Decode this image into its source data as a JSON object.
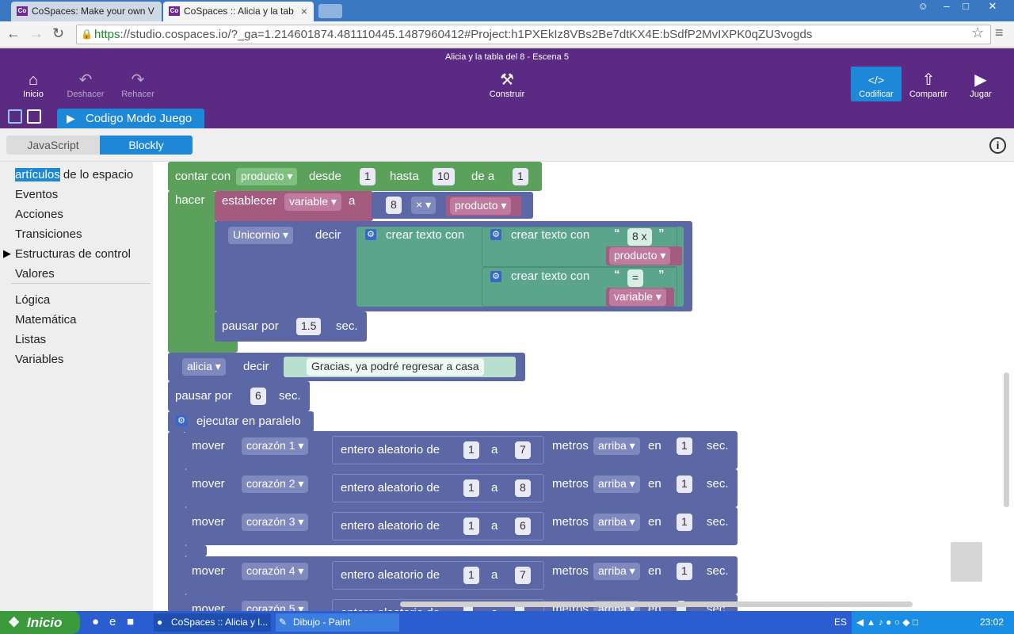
{
  "browser": {
    "tabs": [
      {
        "title": "CoSpaces: Make your own V"
      },
      {
        "title": "CoSpaces :: Alicia y la tab"
      }
    ],
    "url_scheme": "https",
    "url_rest": "://studio.cospaces.io/?_ga=1.214601874.481110445.1487960412#Project:h1PXEkIz8VBs2Be7dtKX4E:bSdfP2MvIXPK0qZU3vogds"
  },
  "app": {
    "title": "Alicia y la tabla del 8 - Escena 5",
    "left_buttons": [
      "Inicio",
      "Deshacer",
      "Rehacer"
    ],
    "center_button": "Construir",
    "right_buttons": [
      "Codificar",
      "Compartir",
      "Jugar"
    ],
    "mode_tab": "Codigo Modo Juego",
    "seg_js": "JavaScript",
    "seg_blockly": "Blockly"
  },
  "sidebar": {
    "selected_highlight": "artículos",
    "selected_rest": " de lo espacio",
    "items": [
      "Eventos",
      "Acciones",
      "Transiciones",
      "Estructuras de control",
      "Valores"
    ],
    "items2": [
      "Lógica",
      "Matemática",
      "Listas",
      "Variables"
    ]
  },
  "blocks": {
    "count_kw": "contar con",
    "count_var": "producto",
    "desde": "desde",
    "from": "1",
    "hasta": "hasta",
    "to": "10",
    "dea": "de a",
    "step": "1",
    "hacer": "hacer",
    "set_kw": "establecer",
    "set_var": "variable",
    "set_a": "a",
    "mult_a": "8",
    "mult_op": "×",
    "mult_b": "producto",
    "say_obj": "Unicornio",
    "say_kw": "decir",
    "text_kw": "crear texto con",
    "text1": "8 x",
    "text1_var": "producto",
    "text2": "=",
    "text2_var": "variable",
    "pause_kw": "pausar por",
    "pause1": "1.5",
    "sec": "sec.",
    "say2_obj": "alicia",
    "say2_text": "Gracias, ya podré regresar a casa",
    "pause2": "6",
    "parallel": "ejecutar en paralelo",
    "move_kw": "mover",
    "random_kw": "entero aleatorio de",
    "random_a": "a",
    "metros": "metros",
    "dir": "arriba",
    "en": "en",
    "moves": [
      {
        "obj": "corazón 1",
        "from": "1",
        "to": "7",
        "time": "1"
      },
      {
        "obj": "corazón 2",
        "from": "1",
        "to": "8",
        "time": "1"
      },
      {
        "obj": "corazón 3",
        "from": "1",
        "to": "6",
        "time": "1"
      },
      {
        "obj": "corazón 4",
        "from": "1",
        "to": "7",
        "time": "1"
      },
      {
        "obj": "corazón 5",
        "from": "",
        "to": "",
        "time": ""
      }
    ]
  },
  "taskbar": {
    "start": "Inicio",
    "tasks": [
      "CoSpaces :: Alicia y l...",
      "Dibujo - Paint"
    ],
    "lang": "ES",
    "clock": "23:02"
  }
}
